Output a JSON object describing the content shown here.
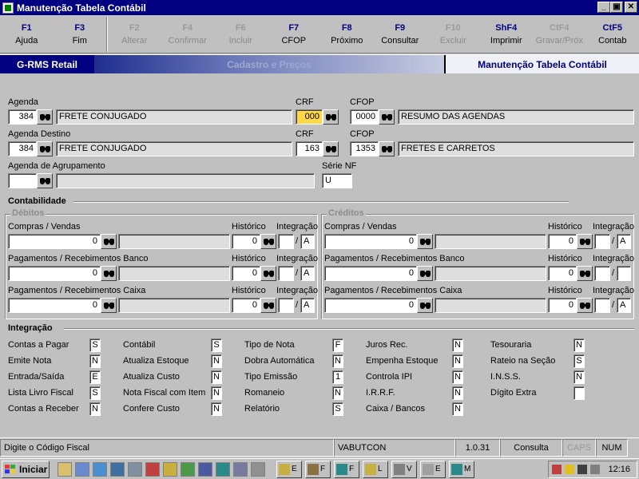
{
  "window": {
    "title": "Manutenção Tabela Contábil",
    "btn_min": "_",
    "btn_max": "▣",
    "btn_close": "✕"
  },
  "fkeys": [
    {
      "key": "F1",
      "label": "Ajuda",
      "enabled": true
    },
    {
      "key": "F3",
      "label": "Fim",
      "enabled": true
    },
    {
      "key": "F2",
      "label": "Alterar",
      "enabled": false
    },
    {
      "key": "F4",
      "label": "Confirmar",
      "enabled": false
    },
    {
      "key": "F6",
      "label": "Incluir",
      "enabled": false
    },
    {
      "key": "F7",
      "label": "CFOP",
      "enabled": true
    },
    {
      "key": "F8",
      "label": "Próximo",
      "enabled": true
    },
    {
      "key": "F9",
      "label": "Consultar",
      "enabled": true
    },
    {
      "key": "F10",
      "label": "Excluir",
      "enabled": false
    },
    {
      "key": "ShF4",
      "label": "Imprimir",
      "enabled": true
    },
    {
      "key": "CtF4",
      "label": "Gravar/Próx",
      "enabled": false
    },
    {
      "key": "CtF5",
      "label": "Contab",
      "enabled": true
    }
  ],
  "banner": {
    "app": "G-RMS Retail",
    "module": "Cadastro e Preços",
    "screen": "Manutenção Tabela Contábil"
  },
  "form": {
    "agenda": {
      "label": "Agenda",
      "code": "384",
      "desc": "FRETE CONJUGADO"
    },
    "crf1": {
      "label": "CRF",
      "value": "000"
    },
    "cfop1": {
      "label": "CFOP",
      "code": "0000",
      "desc": "RESUMO DAS AGENDAS"
    },
    "agenda_destino": {
      "label": "Agenda Destino",
      "code": "384",
      "desc": "FRETE CONJUGADO"
    },
    "crf2": {
      "label": "CRF",
      "value": "163"
    },
    "cfop2": {
      "label": "CFOP",
      "code": "1353",
      "desc": "FRETES E CARRETOS"
    },
    "agenda_agrup": {
      "label": "Agenda de Agrupamento",
      "code": "",
      "desc": ""
    },
    "serie_nf": {
      "label": "Série NF",
      "value": "U"
    }
  },
  "contabilidade": {
    "title": "Contabilidade",
    "debitos": {
      "title": "Débitos",
      "rows": [
        {
          "label": "Compras / Vendas",
          "value": "0",
          "hist_label": "Histórico",
          "hist": "0",
          "integ_label": "Integração",
          "integ_a": "",
          "integ_b": "A"
        },
        {
          "label": "Pagamentos / Recebimentos Banco",
          "value": "0",
          "hist_label": "Histórico",
          "hist": "0",
          "integ_label": "Integração",
          "integ_a": "",
          "integ_b": "A"
        },
        {
          "label": "Pagamentos / Recebimentos Caixa",
          "value": "0",
          "hist_label": "Histórico",
          "hist": "0",
          "integ_label": "Integração",
          "integ_a": "",
          "integ_b": "A"
        }
      ]
    },
    "creditos": {
      "title": "Créditos",
      "rows": [
        {
          "label": "Compras / Vendas",
          "value": "0",
          "hist_label": "Histórico",
          "hist": "0",
          "integ_label": "Integração",
          "integ_a": "",
          "integ_b": "A"
        },
        {
          "label": "Pagamentos / Recebimentos Banco",
          "value": "0",
          "hist_label": "Histórico",
          "hist": "0",
          "integ_label": "Integração",
          "integ_a": "",
          "integ_b": ""
        },
        {
          "label": "Pagamentos / Recebimentos Caixa",
          "value": "0",
          "hist_label": "Histórico",
          "hist": "0",
          "integ_label": "Integração",
          "integ_a": "",
          "integ_b": "A"
        }
      ]
    },
    "slash": "/"
  },
  "integracao": {
    "title": "Integração",
    "col1": [
      {
        "label": "Contas a Pagar",
        "value": "S"
      },
      {
        "label": "Emite Nota",
        "value": "N"
      },
      {
        "label": "Entrada/Saída",
        "value": "E"
      },
      {
        "label": "Lista Livro Fiscal",
        "value": "S"
      },
      {
        "label": "Contas a Receber",
        "value": "N"
      }
    ],
    "col2": [
      {
        "label": "Contábil",
        "value": "S"
      },
      {
        "label": "Atualiza Estoque",
        "value": "N"
      },
      {
        "label": "Atualiza Custo",
        "value": "N"
      },
      {
        "label": "Nota Fiscal com Item",
        "value": "N"
      },
      {
        "label": "Confere Custo",
        "value": "N"
      }
    ],
    "col3": [
      {
        "label": "Tipo de Nota",
        "value": "F"
      },
      {
        "label": "Dobra Automática",
        "value": "N"
      },
      {
        "label": "Tipo Emissão",
        "value": "1"
      },
      {
        "label": "Romaneio",
        "value": "N"
      },
      {
        "label": "Relatório",
        "value": "S"
      }
    ],
    "col4": [
      {
        "label": "Juros Rec.",
        "value": "N"
      },
      {
        "label": "Empenha Estoque",
        "value": "N"
      },
      {
        "label": "Controla IPI",
        "value": "N"
      },
      {
        "label": "I.R.R.F.",
        "value": "N"
      },
      {
        "label": "Caixa / Bancos",
        "value": "N"
      }
    ],
    "col5": [
      {
        "label": "Tesouraria",
        "value": "N"
      },
      {
        "label": "Rateio na Seção",
        "value": "S"
      },
      {
        "label": "I.N.S.S.",
        "value": "N"
      },
      {
        "label": "Dígito Extra",
        "value": ""
      }
    ]
  },
  "status": {
    "message": "Digite o Código Fiscal",
    "user": "VABUTCON",
    "version": "1.0.31",
    "mode": "Consulta",
    "caps": "CAPS",
    "num": "NUM"
  },
  "taskbar": {
    "start": "Iniciar",
    "tasks": [
      "E",
      "F",
      "F",
      "L",
      "V",
      "E",
      "M"
    ],
    "clock": "12:16"
  }
}
